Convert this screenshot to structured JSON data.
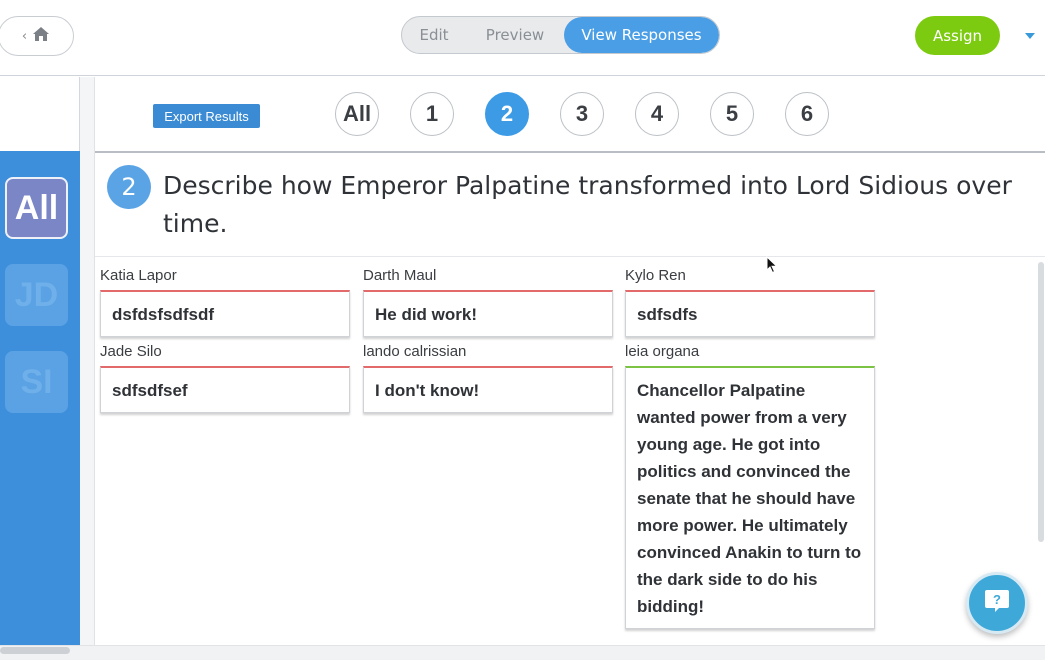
{
  "topbar": {
    "modes": {
      "edit": "Edit",
      "preview": "Preview",
      "view_responses": "View Responses"
    },
    "assign_label": "Assign"
  },
  "sidebar": {
    "avatars": [
      {
        "initials": "All",
        "active": true
      },
      {
        "initials": "JD",
        "active": false
      },
      {
        "initials": "SI",
        "active": false
      }
    ]
  },
  "toolbar": {
    "export_label": "Export Results"
  },
  "question_nav": {
    "items": [
      "All",
      "1",
      "2",
      "3",
      "4",
      "5",
      "6"
    ],
    "active": "2"
  },
  "question": {
    "number": "2",
    "text": "Describe how Emperor Palpatine transformed into Lord Sidious over time."
  },
  "responses": [
    {
      "name": "Katia Lapor",
      "answer": "dsfdsfsdfsdf",
      "status": "incorrect"
    },
    {
      "name": "Darth Maul",
      "answer": "He did work!",
      "status": "incorrect"
    },
    {
      "name": "Kylo Ren",
      "answer": "sdfsdfs",
      "status": "incorrect"
    },
    {
      "name": "Jade Silo",
      "answer": "sdfsdfsef",
      "status": "incorrect"
    },
    {
      "name": "lando calrissian",
      "answer": "I don't know!",
      "status": "incorrect"
    },
    {
      "name": "leia organa",
      "answer": "Chancellor Palpatine wanted power from a very young age. He got into politics and convinced the senate that he should have more power. He ultimately convinced Anakin to turn to the dark side to do his bidding!",
      "status": "correct"
    }
  ],
  "colors": {
    "accent_blue": "#4a9ee6",
    "sidebar_blue": "#3d8fdb",
    "assign_green": "#7ccb10",
    "incorrect_red": "#e26a6a",
    "correct_green": "#7cc243"
  },
  "icons": {
    "home": "home-icon",
    "back": "chevron-left-icon",
    "dropdown": "caret-down-icon",
    "help": "help-chat-icon",
    "cursor": "mouse-pointer-icon"
  }
}
